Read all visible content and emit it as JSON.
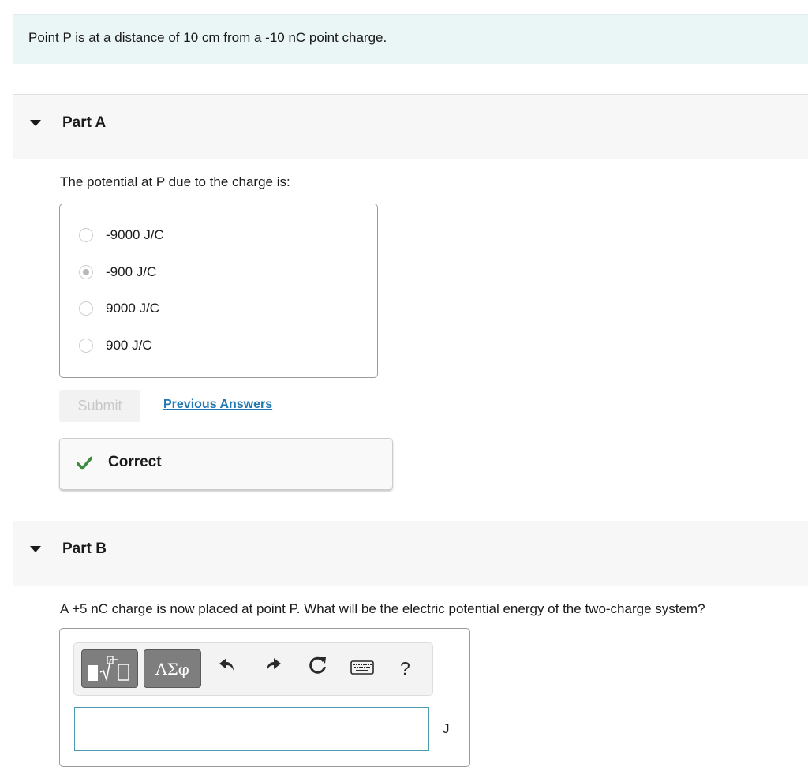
{
  "intro": {
    "text": "Point P is at a distance of 10 cm from a -10 nC point charge."
  },
  "part_a": {
    "title": "Part A",
    "question": "The potential at P due to the charge is:",
    "options": [
      {
        "label": "-9000 J/C",
        "selected": false
      },
      {
        "label": "-900 J/C",
        "selected": true
      },
      {
        "label": "9000 J/C",
        "selected": false
      },
      {
        "label": "900 J/C",
        "selected": false
      }
    ],
    "submit_label": "Submit",
    "previous_answers_label": "Previous Answers",
    "feedback": {
      "text": "Correct",
      "icon": "checkmark-icon",
      "color": "#3b8a3e"
    }
  },
  "part_b": {
    "title": "Part B",
    "question": "A +5 nC charge is now placed at point P. What will be the electric potential energy of the two-charge system?",
    "toolbar": {
      "templates_icon": "templates-icon",
      "symbols_label": "ΑΣφ",
      "undo_icon": "undo-icon",
      "redo_icon": "redo-icon",
      "reset_icon": "reset-icon",
      "keyboard_icon": "keyboard-icon",
      "help_label": "?"
    },
    "answer_value": "",
    "unit": "J"
  },
  "colors": {
    "intro_background": "#eaf6f5",
    "link": "#1f77b4",
    "input_border": "#4a9ab0",
    "success": "#3b8a3e"
  }
}
